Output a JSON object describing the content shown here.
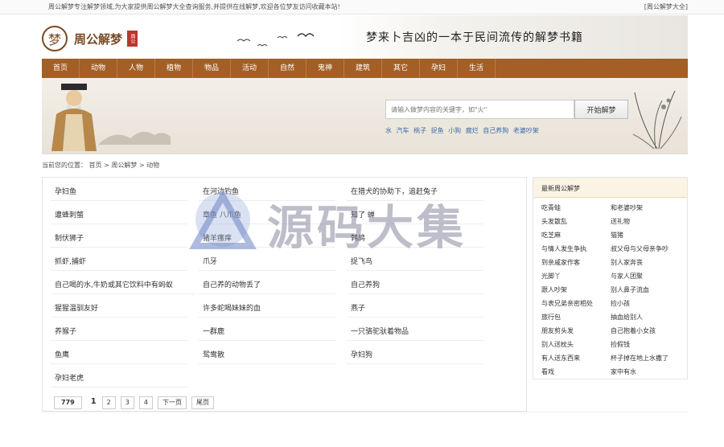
{
  "topbar": {
    "intro": "周公解梦专注解梦领域,为大家提供周公解梦大全查询服务,并提供在线解梦,欢迎各位梦友访问收藏本站!",
    "fav": "[周公解梦大全]"
  },
  "logo": {
    "char": "梦",
    "name": "周公解梦",
    "seal": "周公"
  },
  "slogan": "梦来卜吉凶的一本于民间流传的解梦书籍",
  "nav": [
    "首页",
    "动物",
    "人物",
    "植物",
    "物品",
    "活动",
    "自然",
    "鬼神",
    "建筑",
    "其它",
    "孕妇",
    "生活"
  ],
  "search": {
    "placeholder": "请输入做梦内容的关键字，如\"火\"",
    "button": "开始解梦"
  },
  "hot": [
    "水",
    "汽车",
    "桃子",
    "捉鱼",
    "小狗",
    "腐烂",
    "自己养狗",
    "老婆吵架"
  ],
  "breadcrumb": "当前您的位置： 首页 > 周公解梦 > 动物",
  "items": [
    [
      "孕妇鱼",
      "在河边钓鱼",
      "在猎犬的协助下，追赶兔子"
    ],
    [
      "遭蜂刺螫",
      "章鱼 八爪鱼",
      "知了 蝉"
    ],
    [
      "制伏狮子",
      "猪羊瘙痒",
      "鹁鸪"
    ],
    [
      "抓虾,捕虾",
      "爪牙",
      "捉飞鸟"
    ],
    [
      "自己喝的水,牛奶或其它饮料中有蚂蚁",
      "自己养的动物丢了",
      "自己养狗"
    ],
    [
      "猩猩温驯友好",
      "许多蛇喝妹妹的血",
      "燕子"
    ],
    [
      "养猴子",
      "一群鹿",
      "一只骆驼驮着物品"
    ],
    [
      "鱼鹰",
      "鸳鸯散",
      "孕妇狗"
    ],
    [
      "孕妇老虎",
      "",
      ""
    ]
  ],
  "pager": {
    "total": "779",
    "current": "1",
    "pages": [
      "2",
      "3",
      "4"
    ],
    "next": "下一页",
    "last": "尾页"
  },
  "side": {
    "title": "最新周公解梦",
    "left": [
      "吃青蛙",
      "头发散乱",
      "吃芝麻",
      "与情人发生争执",
      "到亲戚家作客",
      "光脚丫",
      "跟人吵架",
      "与表兄弟亲密相处",
      "旅行包",
      "朋友剪头发",
      "别人送枕头",
      "有人送东西来",
      "看戏"
    ],
    "right": [
      "和老婆吵架",
      "送礼物",
      "猫猪",
      "叔父母与父母亲争吵",
      "别人家奔丧",
      "与家人团聚",
      "别人鼻子流血",
      "捡小孩",
      "抽血给别人",
      "自己抱着小女孩",
      "捡假钱",
      "杯子掉在地上水撒了",
      "家中有水"
    ]
  },
  "watermark": "源码大集"
}
